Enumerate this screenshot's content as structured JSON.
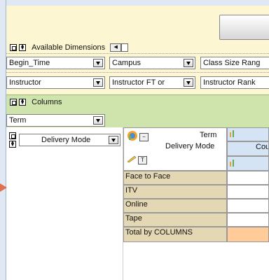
{
  "available_dimensions": {
    "label": "Available Dimensions",
    "items": [
      "Begin_Time",
      "Campus",
      "Class Size Rang",
      "Instructor",
      "Instructor FT or",
      "Instructor Rank"
    ]
  },
  "columns_panel": {
    "label": "Columns",
    "items": [
      "Term"
    ]
  },
  "rows_panel": {
    "items": [
      "Delivery Mode"
    ]
  },
  "grid": {
    "col_dimension_label": "Term",
    "row_dimension_label": "Delivery Mode",
    "col_value_partial": "Cour",
    "rows": [
      "Face to Face",
      "ITV",
      "Online",
      "Tape",
      "Total by COLUMNS"
    ]
  },
  "colors": {
    "dimension_panel": "#fdf6d3",
    "columns_panel": "#cfe3ad",
    "row_header": "#e4d7b4",
    "total_cell": "#ffcc99",
    "arrow": "#e07050"
  },
  "icons": {
    "panel_toggle": "square-icon",
    "reorder": "updown-icon",
    "dropdown": "chevron-down-icon",
    "chart": "chart-icon",
    "pencil": "pencil-icon"
  }
}
